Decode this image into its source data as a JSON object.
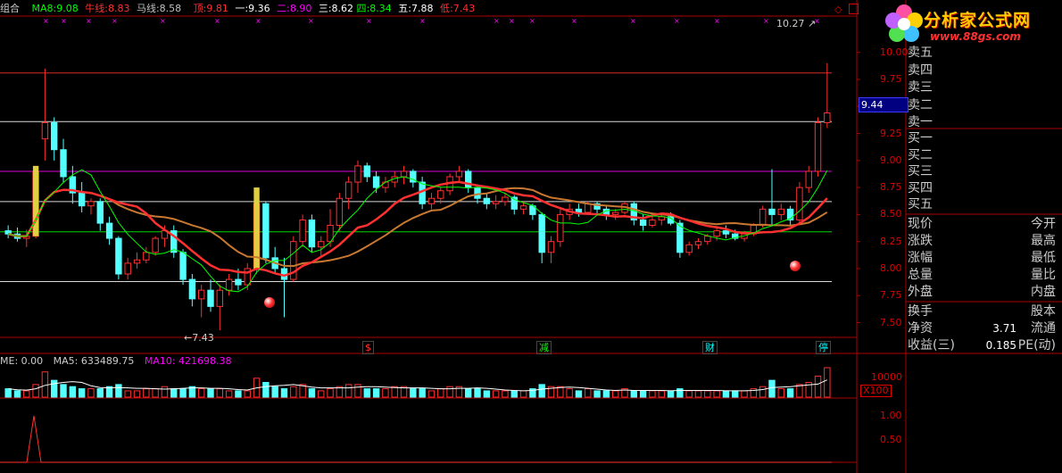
{
  "indicator_header": {
    "title": "组合",
    "ma8": {
      "label": "MA8:",
      "value": "9.08",
      "color": "#00ff00"
    },
    "niu": {
      "label": "牛线:",
      "value": "8.83",
      "color": "#ff3030"
    },
    "ma": {
      "label": "马线:",
      "value": "8.58",
      "color": "#c0c0c0"
    },
    "top": {
      "label": "顶:",
      "value": "9.81",
      "color": "#ff3030"
    },
    "one": {
      "label": "一:",
      "value": "9.36",
      "color": "#ffffff"
    },
    "two": {
      "label": "二:",
      "value": "8.90",
      "color": "#ff00ff"
    },
    "three": {
      "label": "三:",
      "value": "8.62",
      "color": "#ffffff"
    },
    "four": {
      "label": "四:",
      "value": "8.34",
      "color": "#00ff00"
    },
    "five": {
      "label": "五:",
      "value": "7.88",
      "color": "#ffffff"
    },
    "low": {
      "label": "低:",
      "value": "7.43",
      "color": "#ff3030"
    }
  },
  "price_axis": [
    "10.00",
    "9.75",
    "9.50",
    "9.25",
    "9.00",
    "8.75",
    "8.50",
    "8.25",
    "8.00",
    "7.75",
    "7.50"
  ],
  "current_price": "9.44",
  "annotations": {
    "high": "10.27",
    "low": "7.43"
  },
  "event_marks": [
    {
      "text": "$",
      "color": "#ff3030"
    },
    {
      "text": "减",
      "color": "#00ff00"
    },
    {
      "text": "财",
      "color": "#00ffff"
    },
    {
      "text": "停",
      "color": "#00ffff"
    }
  ],
  "volume_header": {
    "vol": "ME: 0.00",
    "ma5": "MA5: 633489.75",
    "ma10": "MA10: 421698.38"
  },
  "volume_axis": {
    "v1": "10000",
    "unit": "X100"
  },
  "lower_axis": [
    "1.00",
    "0.50"
  ],
  "order_book": {
    "sell": [
      "卖五",
      "卖四",
      "卖三",
      "卖二",
      "卖一"
    ],
    "buy": [
      "买一",
      "买二",
      "买三",
      "买四",
      "买五"
    ]
  },
  "quote_stats": [
    {
      "l": "现价",
      "v": "",
      "r": "今开"
    },
    {
      "l": "涨跌",
      "v": "",
      "r": "最高"
    },
    {
      "l": "涨幅",
      "v": "",
      "r": "最低"
    },
    {
      "l": "总量",
      "v": "",
      "r": "量比"
    },
    {
      "l": "外盘",
      "v": "",
      "r": "内盘"
    }
  ],
  "fund_stats": [
    {
      "l": "换手",
      "v": "",
      "r": "股本"
    },
    {
      "l": "净资",
      "v": "3.71",
      "r": "流通"
    },
    {
      "l": "收益(三)",
      "v": "0.185",
      "r": "PE(动)"
    }
  ],
  "logo": {
    "text": "分析家公式网",
    "url": "www.88gs.com"
  },
  "colors": {
    "up": "#ff3030",
    "down": "#54ffff",
    "niu_line": "#ff3030",
    "ma_line": "#c87830",
    "ma8_line": "#00ff00",
    "grid": "#b00000"
  },
  "chart_data": {
    "type": "candlestick",
    "ylim": [
      7.43,
      10.27
    ],
    "guide_levels": {
      "top": 9.81,
      "one": 9.36,
      "two": 8.9,
      "three": 8.62,
      "four": 8.34,
      "five": 7.88
    },
    "candles": [
      [
        8.35,
        8.4,
        8.28,
        8.32
      ],
      [
        8.32,
        8.38,
        8.25,
        8.28
      ],
      [
        8.28,
        8.36,
        8.2,
        8.3
      ],
      [
        8.3,
        8.95,
        8.28,
        8.9
      ],
      [
        9.2,
        9.85,
        9.0,
        9.35
      ],
      [
        9.35,
        9.4,
        9.0,
        9.1
      ],
      [
        9.1,
        9.2,
        8.8,
        8.85
      ],
      [
        8.85,
        8.95,
        8.6,
        8.7
      ],
      [
        8.7,
        8.8,
        8.52,
        8.58
      ],
      [
        8.58,
        8.65,
        8.5,
        8.62
      ],
      [
        8.62,
        8.65,
        8.35,
        8.42
      ],
      [
        8.42,
        8.48,
        8.22,
        8.28
      ],
      [
        8.28,
        8.3,
        7.9,
        7.95
      ],
      [
        7.95,
        8.1,
        7.9,
        8.05
      ],
      [
        8.05,
        8.15,
        8.0,
        8.08
      ],
      [
        8.08,
        8.2,
        8.05,
        8.15
      ],
      [
        8.15,
        8.3,
        8.12,
        8.28
      ],
      [
        8.28,
        8.4,
        8.2,
        8.35
      ],
      [
        8.35,
        8.4,
        8.1,
        8.15
      ],
      [
        8.15,
        8.18,
        7.85,
        7.9
      ],
      [
        7.9,
        7.95,
        7.65,
        7.72
      ],
      [
        7.72,
        7.85,
        7.55,
        7.8
      ],
      [
        7.8,
        7.9,
        7.6,
        7.65
      ],
      [
        7.65,
        7.85,
        7.43,
        7.8
      ],
      [
        7.8,
        7.95,
        7.75,
        7.9
      ],
      [
        7.9,
        8.0,
        7.8,
        7.85
      ],
      [
        7.85,
        8.05,
        7.8,
        8.0
      ],
      [
        8.0,
        8.75,
        7.95,
        8.6
      ],
      [
        8.6,
        8.62,
        8.05,
        8.1
      ],
      [
        8.1,
        8.2,
        7.95,
        8.0
      ],
      [
        8.0,
        8.1,
        7.55,
        7.9
      ],
      [
        7.9,
        8.3,
        7.88,
        8.25
      ],
      [
        8.25,
        8.5,
        8.2,
        8.45
      ],
      [
        8.45,
        8.5,
        8.15,
        8.2
      ],
      [
        8.2,
        8.3,
        8.1,
        8.25
      ],
      [
        8.25,
        8.55,
        8.2,
        8.4
      ],
      [
        8.4,
        8.7,
        8.35,
        8.65
      ],
      [
        8.65,
        8.85,
        8.55,
        8.8
      ],
      [
        8.8,
        9.0,
        8.7,
        8.95
      ],
      [
        8.95,
        8.98,
        8.8,
        8.85
      ],
      [
        8.85,
        8.9,
        8.7,
        8.75
      ],
      [
        8.75,
        8.85,
        8.7,
        8.8
      ],
      [
        8.8,
        8.9,
        8.75,
        8.85
      ],
      [
        8.85,
        8.95,
        8.78,
        8.9
      ],
      [
        8.9,
        8.92,
        8.75,
        8.8
      ],
      [
        8.8,
        8.85,
        8.55,
        8.6
      ],
      [
        8.6,
        8.7,
        8.55,
        8.65
      ],
      [
        8.65,
        8.75,
        8.6,
        8.72
      ],
      [
        8.72,
        8.88,
        8.68,
        8.85
      ],
      [
        8.85,
        8.95,
        8.8,
        8.9
      ],
      [
        8.9,
        8.92,
        8.7,
        8.75
      ],
      [
        8.75,
        8.78,
        8.6,
        8.65
      ],
      [
        8.65,
        8.7,
        8.55,
        8.6
      ],
      [
        8.6,
        8.68,
        8.55,
        8.62
      ],
      [
        8.62,
        8.7,
        8.58,
        8.66
      ],
      [
        8.66,
        8.68,
        8.5,
        8.55
      ],
      [
        8.55,
        8.62,
        8.5,
        8.58
      ],
      [
        8.58,
        8.6,
        8.45,
        8.5
      ],
      [
        8.5,
        8.52,
        8.05,
        8.15
      ],
      [
        8.15,
        8.3,
        8.05,
        8.25
      ],
      [
        8.25,
        8.55,
        8.2,
        8.5
      ],
      [
        8.5,
        8.6,
        8.45,
        8.55
      ],
      [
        8.55,
        8.6,
        8.48,
        8.52
      ],
      [
        8.52,
        8.62,
        8.5,
        8.6
      ],
      [
        8.6,
        8.62,
        8.5,
        8.55
      ],
      [
        8.55,
        8.58,
        8.45,
        8.5
      ],
      [
        8.5,
        8.55,
        8.45,
        8.52
      ],
      [
        8.52,
        8.62,
        8.5,
        8.6
      ],
      [
        8.6,
        8.62,
        8.4,
        8.45
      ],
      [
        8.45,
        8.5,
        8.35,
        8.4
      ],
      [
        8.4,
        8.48,
        8.38,
        8.45
      ],
      [
        8.45,
        8.5,
        8.4,
        8.48
      ],
      [
        8.48,
        8.52,
        8.4,
        8.42
      ],
      [
        8.42,
        8.45,
        8.1,
        8.15
      ],
      [
        8.15,
        8.25,
        8.12,
        8.22
      ],
      [
        8.22,
        8.28,
        8.18,
        8.25
      ],
      [
        8.25,
        8.32,
        8.22,
        8.3
      ],
      [
        8.3,
        8.38,
        8.26,
        8.35
      ],
      [
        8.35,
        8.4,
        8.28,
        8.32
      ],
      [
        8.32,
        8.36,
        8.26,
        8.28
      ],
      [
        8.28,
        8.35,
        8.25,
        8.32
      ],
      [
        8.32,
        8.42,
        8.3,
        8.4
      ],
      [
        8.4,
        8.58,
        8.38,
        8.55
      ],
      [
        8.55,
        8.92,
        8.4,
        8.5
      ],
      [
        8.5,
        8.6,
        8.45,
        8.55
      ],
      [
        8.55,
        8.58,
        8.4,
        8.45
      ],
      [
        8.45,
        8.8,
        8.4,
        8.75
      ],
      [
        8.75,
        8.95,
        8.7,
        8.9
      ],
      [
        8.9,
        9.4,
        8.85,
        9.35
      ],
      [
        9.35,
        9.9,
        9.3,
        9.44
      ]
    ],
    "volumes": [
      4,
      3,
      3,
      6,
      12,
      8,
      6,
      5,
      4,
      4,
      4,
      5,
      6,
      3,
      3,
      4,
      4,
      5,
      4,
      4,
      5,
      4,
      4,
      4,
      3,
      3,
      3,
      9,
      7,
      5,
      4,
      5,
      6,
      4,
      3,
      4,
      5,
      6,
      6,
      4,
      4,
      4,
      5,
      5,
      4,
      4,
      3,
      4,
      5,
      5,
      4,
      4,
      3,
      3,
      3,
      3,
      3,
      4,
      6,
      5,
      5,
      4,
      3,
      4,
      3,
      3,
      3,
      4,
      3,
      3,
      3,
      3,
      3,
      4,
      3,
      3,
      3,
      3,
      3,
      3,
      3,
      4,
      5,
      8,
      4,
      4,
      6,
      7,
      10,
      14
    ]
  }
}
